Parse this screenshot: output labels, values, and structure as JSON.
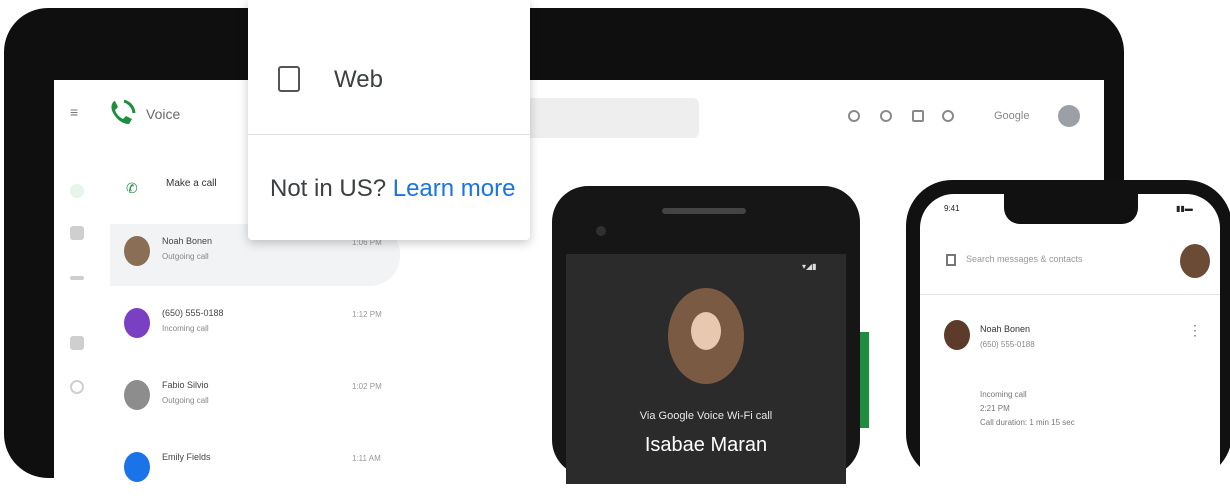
{
  "popup": {
    "web_label": "Web",
    "not_in_us": "Not in US?",
    "learn_more": "Learn more"
  },
  "laptop": {
    "app_title": "Voice",
    "header_brand": "Google",
    "make_call": "Make a call",
    "rows": [
      {
        "name": "Noah Bonen",
        "sub": "Outgoing call",
        "time": "1:06 PM"
      },
      {
        "name": "(650) 555-0188",
        "sub": "Incoming call",
        "time": "1:12 PM"
      },
      {
        "name": "Fabio Silvio",
        "sub": "Outgoing call",
        "time": "1:02 PM"
      },
      {
        "name": "Emily Fields",
        "sub": "",
        "time": "1:11 AM"
      }
    ]
  },
  "android": {
    "call_line": "Via Google Voice Wi-Fi call",
    "caller_name": "Isabae Maran"
  },
  "iphone": {
    "time": "9:41",
    "search_placeholder": "Search messages & contacts",
    "contact_name": "Noah Bonen",
    "contact_number": "(650) 555-0188",
    "detail_1": "Incoming call",
    "detail_2": "2:21 PM",
    "detail_3": "Call duration: 1 min 15 sec"
  },
  "colors": {
    "accent_blue": "#1a73e8",
    "voice_green": "#1e8e3e"
  }
}
